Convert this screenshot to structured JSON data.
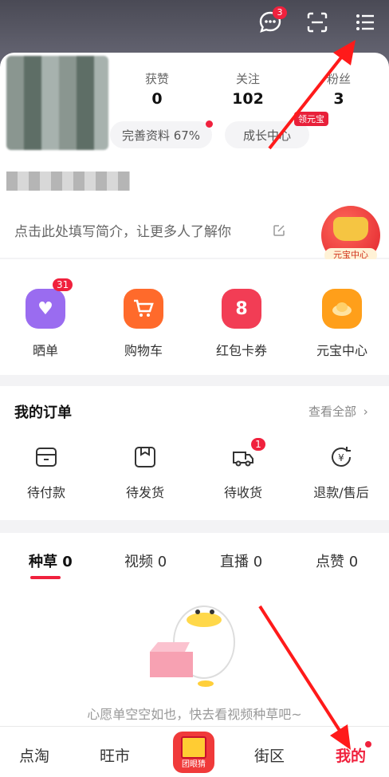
{
  "header": {
    "message_badge": "3",
    "icons": [
      "chat-bubble-icon",
      "scan-icon",
      "menu-icon"
    ]
  },
  "profile": {
    "stats": [
      {
        "label": "获赞",
        "value": "0"
      },
      {
        "label": "关注",
        "value": "102"
      },
      {
        "label": "粉丝",
        "value": "3"
      }
    ],
    "complete_profile": "完善资料 67%",
    "growth_center": "成长中心",
    "yuanbao_tag": "领元宝",
    "bio_placeholder": "点击此处填写简介，让更多人了解你",
    "yuanbao_center_badge": "元宝中心"
  },
  "quick_grid": [
    {
      "label": "晒单",
      "badge": "31",
      "icon": "photo-heart-icon",
      "color": "#9a6cf0"
    },
    {
      "label": "购物车",
      "badge": "",
      "icon": "cart-icon",
      "color": "#ff6a2b"
    },
    {
      "label": "红包卡券",
      "badge": "",
      "icon": "coupon-icon",
      "color": "#f23d55"
    },
    {
      "label": "元宝中心",
      "badge": "",
      "icon": "ingot-icon",
      "color": "#ff9f1a"
    }
  ],
  "orders": {
    "title": "我的订单",
    "view_all": "查看全部",
    "items": [
      {
        "label": "待付款",
        "badge": "",
        "icon": "wallet-icon"
      },
      {
        "label": "待发货",
        "badge": "",
        "icon": "package-icon"
      },
      {
        "label": "待收货",
        "badge": "1",
        "icon": "truck-icon"
      },
      {
        "label": "退款/售后",
        "badge": "",
        "icon": "refund-icon"
      }
    ]
  },
  "content_tabs": [
    {
      "label": "种草 0",
      "active": true
    },
    {
      "label": "视频 0",
      "active": false
    },
    {
      "label": "直播 0",
      "active": false
    },
    {
      "label": "点赞 0",
      "active": false
    }
  ],
  "empty_state": "心愿单空空如也，快去看视频种草吧~",
  "tabbar": {
    "items": [
      "点淘",
      "旺市",
      "街区",
      "我的"
    ],
    "center_badge": "团眼猜"
  }
}
